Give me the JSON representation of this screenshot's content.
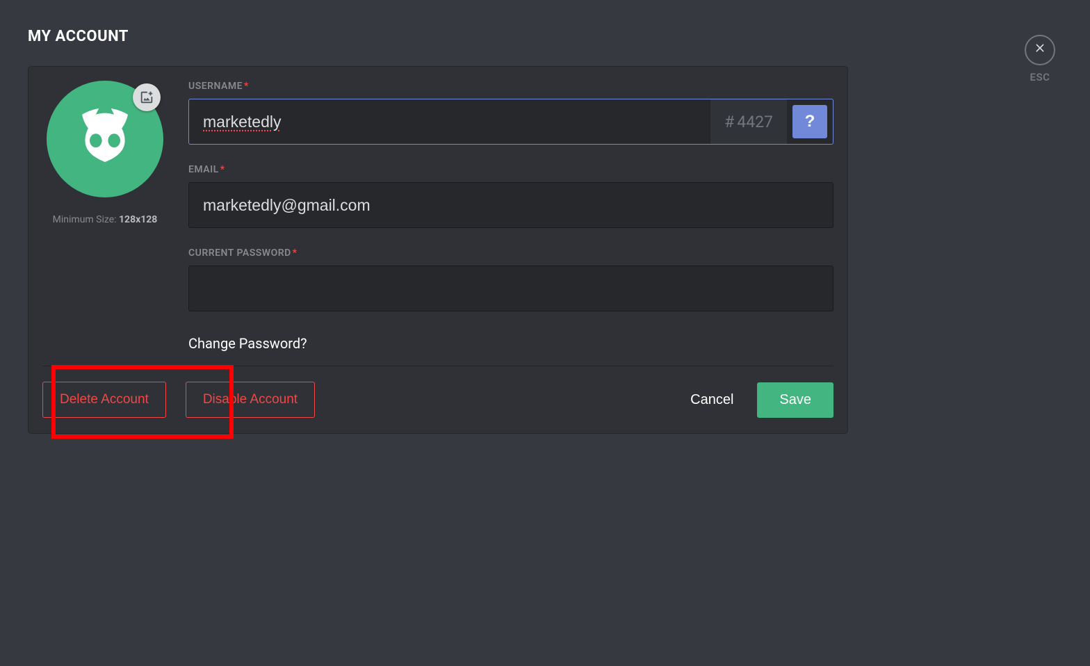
{
  "header": {
    "title": "MY ACCOUNT",
    "esc_label": "ESC"
  },
  "avatar": {
    "min_size_prefix": "Minimum Size: ",
    "min_size_value": "128x128"
  },
  "form": {
    "username": {
      "label": "USERNAME",
      "value": "marketedly",
      "discriminator": "4427",
      "hash": "#",
      "help": "?"
    },
    "email": {
      "label": "EMAIL",
      "value": "marketedly@gmail.com"
    },
    "password": {
      "label": "CURRENT PASSWORD",
      "value": ""
    },
    "change_password": "Change Password?"
  },
  "footer": {
    "delete": "Delete Account",
    "disable": "Disable Account",
    "cancel": "Cancel",
    "save": "Save"
  }
}
